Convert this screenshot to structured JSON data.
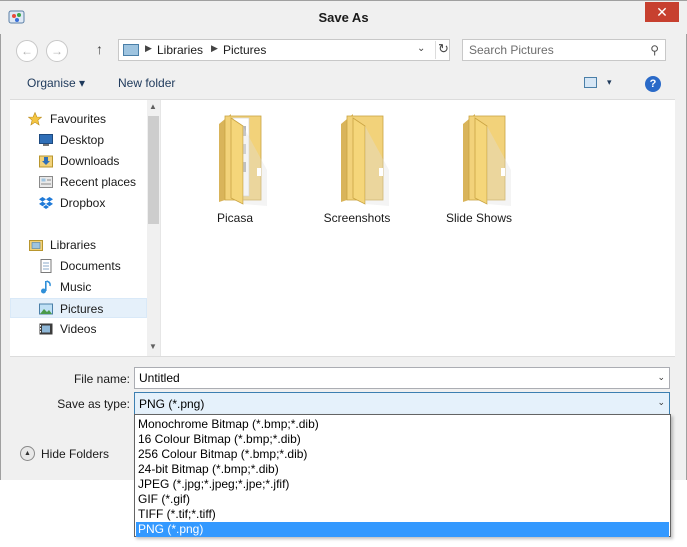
{
  "window": {
    "title": "Save As",
    "close_glyph": "✕"
  },
  "address": {
    "crumbs": [
      "Libraries",
      "Pictures"
    ],
    "separator": "▶"
  },
  "search": {
    "placeholder": "Search Pictures"
  },
  "toolbar": {
    "organise_label": "Organise ▾",
    "new_folder_label": "New folder",
    "view_chevron": "▾",
    "help_glyph": "?"
  },
  "navigation": {
    "items": [
      {
        "label": "Favourites",
        "icon": "star-icon"
      },
      {
        "label": "Desktop",
        "icon": "desktop-icon"
      },
      {
        "label": "Downloads",
        "icon": "downloads-icon"
      },
      {
        "label": "Recent places",
        "icon": "recent-places-icon"
      },
      {
        "label": "Dropbox",
        "icon": "dropbox-icon"
      },
      {
        "label": "Libraries",
        "icon": "libraries-icon"
      },
      {
        "label": "Documents",
        "icon": "documents-icon"
      },
      {
        "label": "Music",
        "icon": "music-icon"
      },
      {
        "label": "Pictures",
        "icon": "pictures-icon",
        "selected": true
      },
      {
        "label": "Videos",
        "icon": "videos-icon"
      }
    ]
  },
  "folders": [
    {
      "name": "Picasa"
    },
    {
      "name": "Screenshots"
    },
    {
      "name": "Slide Shows"
    }
  ],
  "form": {
    "file_name_label": "File name:",
    "file_name_value": "Untitled",
    "save_type_label": "Save as type:",
    "save_type_value": "PNG (*.png)"
  },
  "hide_folders": {
    "label": "Hide Folders",
    "glyph": "▲"
  },
  "save_type_options": [
    "Monochrome Bitmap (*.bmp;*.dib)",
    "16 Colour Bitmap (*.bmp;*.dib)",
    "256 Colour Bitmap (*.bmp;*.dib)",
    "24-bit Bitmap (*.bmp;*.dib)",
    "JPEG (*.jpg;*.jpeg;*.jpe;*.jfif)",
    "GIF (*.gif)",
    "TIFF (*.tif;*.tiff)",
    "PNG (*.png)"
  ],
  "selected_save_type_index": 7,
  "colors": {
    "accent": "#3399ff",
    "close": "#c7402f",
    "folder": "#f5d67a"
  }
}
